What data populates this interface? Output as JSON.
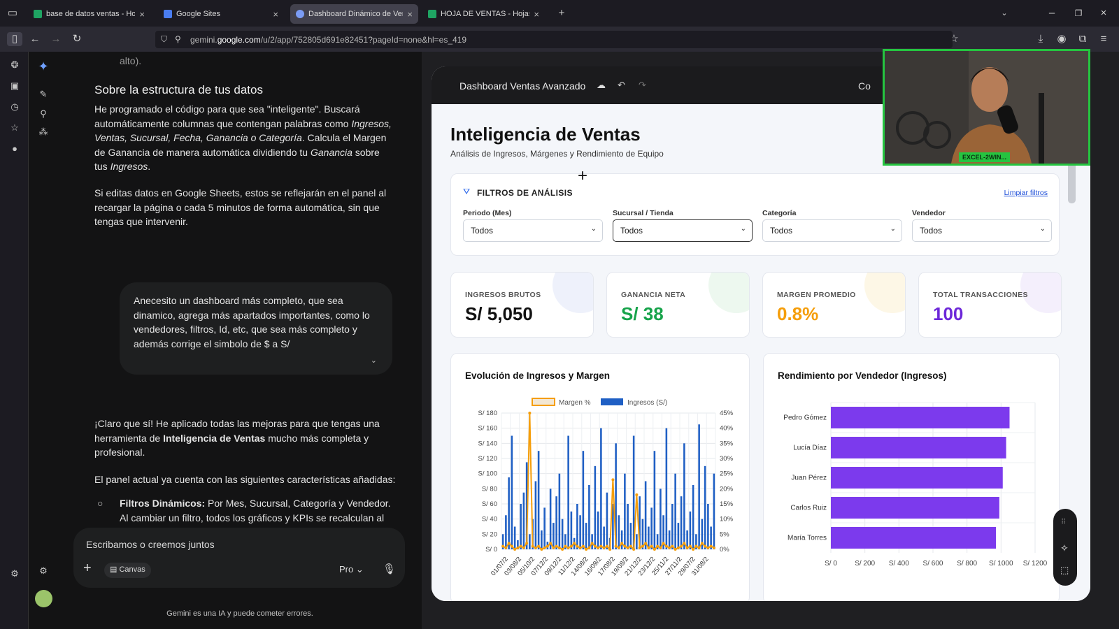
{
  "browser": {
    "tabs": [
      {
        "title": "base de datos ventas - Hojas de",
        "color": "#1fa463"
      },
      {
        "title": "Google Sites",
        "color": "#4a7df0"
      },
      {
        "title": "Dashboard Dinámico de Ventas",
        "color": "#7b9cf5"
      },
      {
        "title": "HOJA DE VENTAS - Hojas de cál",
        "color": "#1fa463"
      }
    ],
    "url_prefix": "gemini.",
    "url_domain": "google.com",
    "url_rest": "/u/2/app/752805d691e82451?pageId=none&hl=es_419"
  },
  "chat": {
    "cut_text": "alto).",
    "section_title": "Sobre la estructura de tus datos",
    "p1_parts": [
      "He programado el código para que sea \"inteligente\". Buscará automáticamente columnas que contengan palabras como ",
      "Ingresos, Ventas, Sucursal, Fecha, Ganancia o Categoría",
      ".  Calcula el Margen de Ganancia de manera automática dividiendo tu ",
      "Ganancia",
      " sobre tus ",
      "Ingresos",
      "."
    ],
    "p2": "Si editas datos en Google Sheets, estos se reflejarán en el panel al recargar la página o cada 5 minutos de forma automática, sin que tengas que intervenir.",
    "user_msg": "Anecesito un dashboard más completo, que sea dinamico, agrega más apartados importantes, como lo vendedores, filtros, Id, etc, que sea más completo y además corrige el simbolo de $ a S/",
    "p3_a": "¡Claro que sí! He aplicado todas las mejoras para que tengas una herramienta de ",
    "p3_b": "Inteligencia de Ventas",
    "p3_c": " mucho más completa y profesional.",
    "p4": "El panel actual ya cuenta con las siguientes características añadidas:",
    "bullet_title": "Filtros Dinámicos:",
    "bullet_text": " Por Mes, Sucursal, Categoría y Vendedor. Al cambiar un filtro, todos los gráficos y KPIs se recalculan al instante.",
    "composer_placeholder": "Escribamos o creemos juntos",
    "canvas_chip": "Canvas",
    "model": "Pro",
    "disclaimer": "Gemini es una IA y puede cometer errores."
  },
  "canvas": {
    "title": "Dashboard Ventas Avanzado",
    "share_cut": "Co"
  },
  "dashboard": {
    "title": "Inteligencia de Ventas",
    "subtitle": "Análisis de Ingresos, Márgenes y Rendimiento de Equipo",
    "filters_title": "FILTROS DE ANÁLISIS",
    "clear_filters": "Limpiar filtros",
    "filters": [
      {
        "label": "Periodo (Mes)",
        "value": "Todos"
      },
      {
        "label": "Sucursal / Tienda",
        "value": "Todos"
      },
      {
        "label": "Categoría",
        "value": "Todos"
      },
      {
        "label": "Vendedor",
        "value": "Todos"
      }
    ],
    "kpis": [
      {
        "label": "INGRESOS BRUTOS",
        "value": "S/ 5,050",
        "color": "#111111"
      },
      {
        "label": "GANANCIA NETA",
        "value": "S/ 38",
        "color": "#16a34a"
      },
      {
        "label": "MARGEN PROMEDIO",
        "value": "0.8%",
        "color": "#f59e0b"
      },
      {
        "label": "TOTAL TRANSACCIONES",
        "value": "100",
        "color": "#6d28d9"
      }
    ],
    "video_label": "EXCEL-2WIN..."
  },
  "chart_data": [
    {
      "type": "bar",
      "title": "Evolución de Ingresos y Margen",
      "series": [
        {
          "name": "Ingresos (S/)",
          "type": "bar",
          "color": "#1f5fc4",
          "axis": "left",
          "values": [
            20,
            45,
            95,
            150,
            30,
            12,
            60,
            75,
            115,
            20,
            40,
            90,
            130,
            25,
            55,
            10,
            80,
            35,
            70,
            100,
            40,
            20,
            150,
            50,
            15,
            60,
            45,
            130,
            35,
            85,
            20,
            110,
            50,
            160,
            30,
            75,
            15,
            60,
            140,
            45,
            25,
            100,
            60,
            35,
            150,
            20,
            70,
            40,
            90,
            30,
            55,
            130,
            20,
            80,
            45,
            160,
            25,
            60,
            100,
            35,
            70,
            140,
            25,
            50,
            85,
            20,
            165,
            40,
            110,
            60,
            30,
            100
          ]
        },
        {
          "name": "Margen %",
          "type": "line",
          "color": "#f59e0b",
          "axis": "right",
          "values": [
            1,
            0.5,
            2,
            1,
            0,
            0.5,
            1,
            0.5,
            2,
            45,
            1,
            0.5,
            1,
            0,
            0.5,
            1,
            2,
            0.5,
            1,
            0.5,
            0,
            1,
            0.5,
            1,
            2,
            1,
            0.5,
            1,
            0,
            0.5,
            2,
            1,
            0.5,
            1,
            0.5,
            1,
            0,
            23,
            1,
            0.5,
            2,
            1,
            0.5,
            1,
            0,
            18,
            0.5,
            1,
            2,
            0.5,
            1,
            0,
            1,
            0.5,
            2,
            1,
            0.5,
            1,
            0,
            0.5,
            1,
            2,
            0.5,
            1,
            0,
            1,
            0.5,
            2,
            1,
            0.5,
            1,
            0.5
          ]
        }
      ],
      "x_tick_labels": [
        "01/07/2",
        "03/08/2",
        "05/10/2",
        "07/12/2",
        "09/12/2",
        "11/12/2",
        "14/08/2",
        "16/09/2",
        "17/08/2",
        "19/08/2",
        "21/12/2",
        "23/12/2",
        "25/11/2",
        "27/11/2",
        "29/07/2",
        "31/08/2"
      ],
      "y_left_ticks": [
        "S/ 0",
        "S/ 20",
        "S/ 40",
        "S/ 60",
        "S/ 80",
        "S/ 100",
        "S/ 120",
        "S/ 140",
        "S/ 160",
        "S/ 180"
      ],
      "y_right_ticks": [
        "0%",
        "5%",
        "10%",
        "15%",
        "20%",
        "25%",
        "30%",
        "35%",
        "40%",
        "45%"
      ],
      "ylim_left": [
        0,
        180
      ],
      "ylim_right": [
        0,
        45
      ],
      "legend_position": "top"
    },
    {
      "type": "bar",
      "orientation": "horizontal",
      "title": "Rendimiento por Vendedor (Ingresos)",
      "categories": [
        "Pedro Gómez",
        "Lucía Díaz",
        "Juan Pérez",
        "Carlos Ruiz",
        "María Torres"
      ],
      "values": [
        1050,
        1030,
        1010,
        990,
        970
      ],
      "color": "#7c3aed",
      "x_ticks": [
        "S/ 0",
        "S/ 200",
        "S/ 400",
        "S/ 600",
        "S/ 800",
        "S/ 1000",
        "S/ 1200"
      ],
      "xlim": [
        0,
        1200
      ]
    }
  ]
}
